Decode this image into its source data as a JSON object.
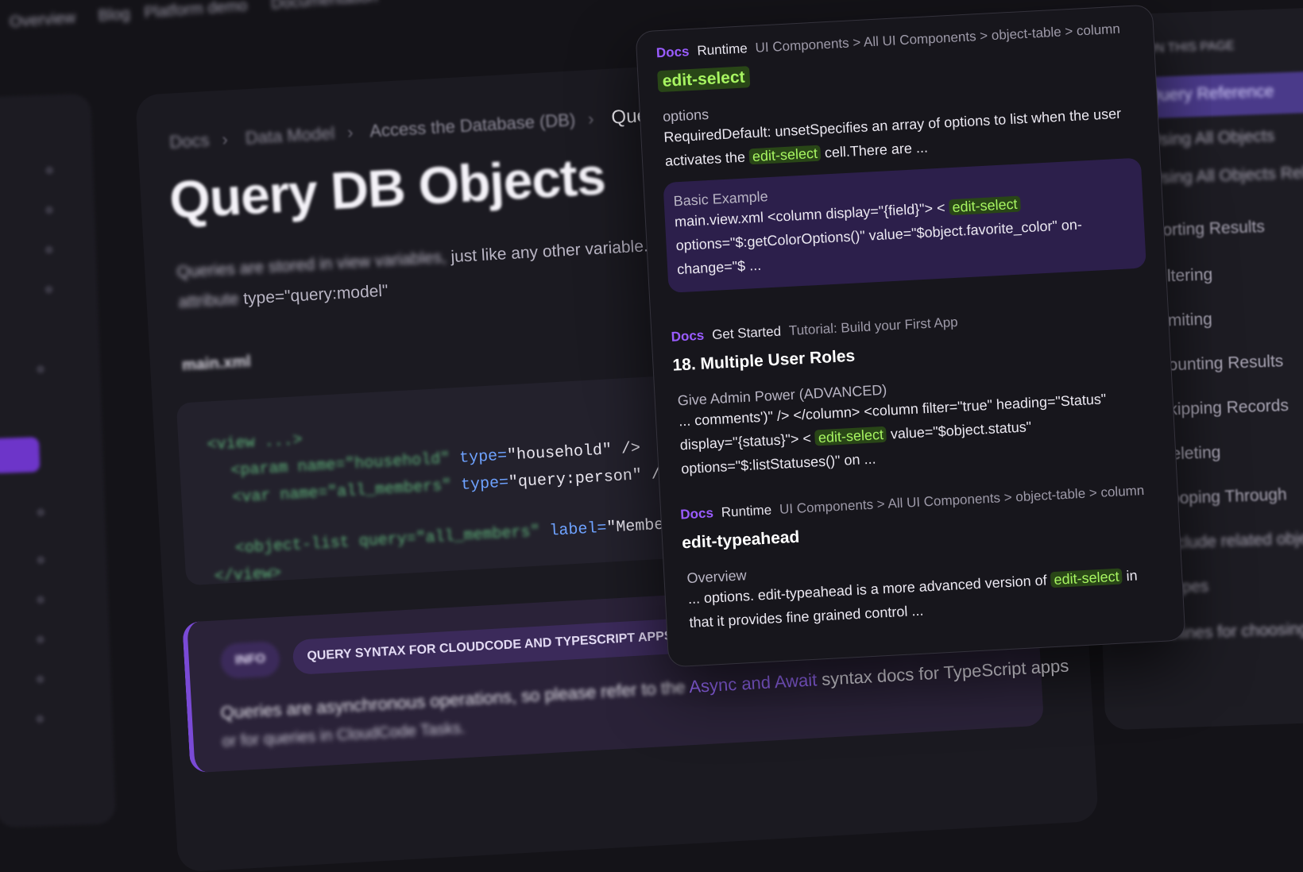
{
  "topnav": {
    "items": [
      "Overview",
      "Blog",
      "Platform demo",
      "Documentation"
    ]
  },
  "breadcrumb": {
    "items": [
      "Docs",
      "Data Model",
      "Access the Database (DB)"
    ],
    "current": "Query DB"
  },
  "page": {
    "title": "Query DB Objects",
    "lead_blur": "Queries are stored in view variables,",
    "lead_clear": " just like any other variable. A quer",
    "lead_line2": "attribute",
    "lead_pill": "type=\"query:model\"",
    "file_label": "main.xml",
    "code": {
      "line1_tag": "<view ...>",
      "line2_tag": "<param name=\"household\"",
      "line2_attr": "type=",
      "line2_val": "\"household\" />",
      "line3_tag": "<var name=\"all_members\"",
      "line3_attr": "type=",
      "line3_val": "\"query:person\" />",
      "line4_tag": "<object-list query=\"all_members\"",
      "line4_attr": "label=",
      "line4_val": "\"Members\" />",
      "line5_tag": "</view>"
    },
    "callout": {
      "badge1": "INFO",
      "badge2": "QUERY SYNTAX FOR CLOUDCODE AND TYPESCRIPT APPS",
      "text_blur": "Queries are asynchronous operations, so please refer to the",
      "link": "Async and Await",
      "text_after": " syntax docs for TypeScript apps",
      "text_line2": "or for queries in CloudCode Tasks."
    }
  },
  "toc": {
    "items": [
      "ON THIS PAGE",
      "Query Reference",
      "Using All Objects",
      "Using All Objects Relationship",
      "Sorting Results",
      "Filtering",
      "Limiting",
      "Counting Results",
      "Skipping Records",
      "Deleting",
      "Looping Through",
      "Include related objects",
      "Types",
      "Guidelines for choosing array and query"
    ]
  },
  "search_results": [
    {
      "docs": "Docs",
      "section": "Runtime",
      "path": "UI Components > All UI Components > object-table > column",
      "title": "edit-select",
      "title_highlight": true,
      "snippets": [
        {
          "heading": "options",
          "pre": "RequiredDefault: unsetSpecifies an array of options to list when the user activates the ",
          "hl": "edit-select",
          "post": " cell.There are ..."
        },
        {
          "heading": "Basic Example",
          "pre": "main.view.xml <column display=\"{field}\"> < ",
          "hl": "edit-select",
          "post": " options=\"$:getColorOptions()\" value=\"$object.favorite_color\" on-change=\"$ ..."
        }
      ]
    },
    {
      "docs": "Docs",
      "section": "Get Started",
      "path": "Tutorial: Build your First App",
      "title": "18. Multiple User Roles",
      "title_highlight": false,
      "snippets": [
        {
          "heading": "Give Admin Power (ADVANCED)",
          "pre": "... comments')\" /> </column> <column filter=\"true\" heading=\"Status\" display=\"{status}\"> < ",
          "hl": "edit-select",
          "post": " value=\"$object.status\" options=\"$:listStatuses()\" on ..."
        }
      ]
    },
    {
      "docs": "Docs",
      "section": "Runtime",
      "path": "UI Components > All UI Components > object-table > column",
      "title": "edit-typeahead",
      "title_highlight": false,
      "snippets": [
        {
          "heading": "Overview",
          "pre": "... options. edit-typeahead is a more advanced version of ",
          "hl": "edit-select",
          "post": " in that it provides fine grained control ..."
        }
      ]
    }
  ]
}
